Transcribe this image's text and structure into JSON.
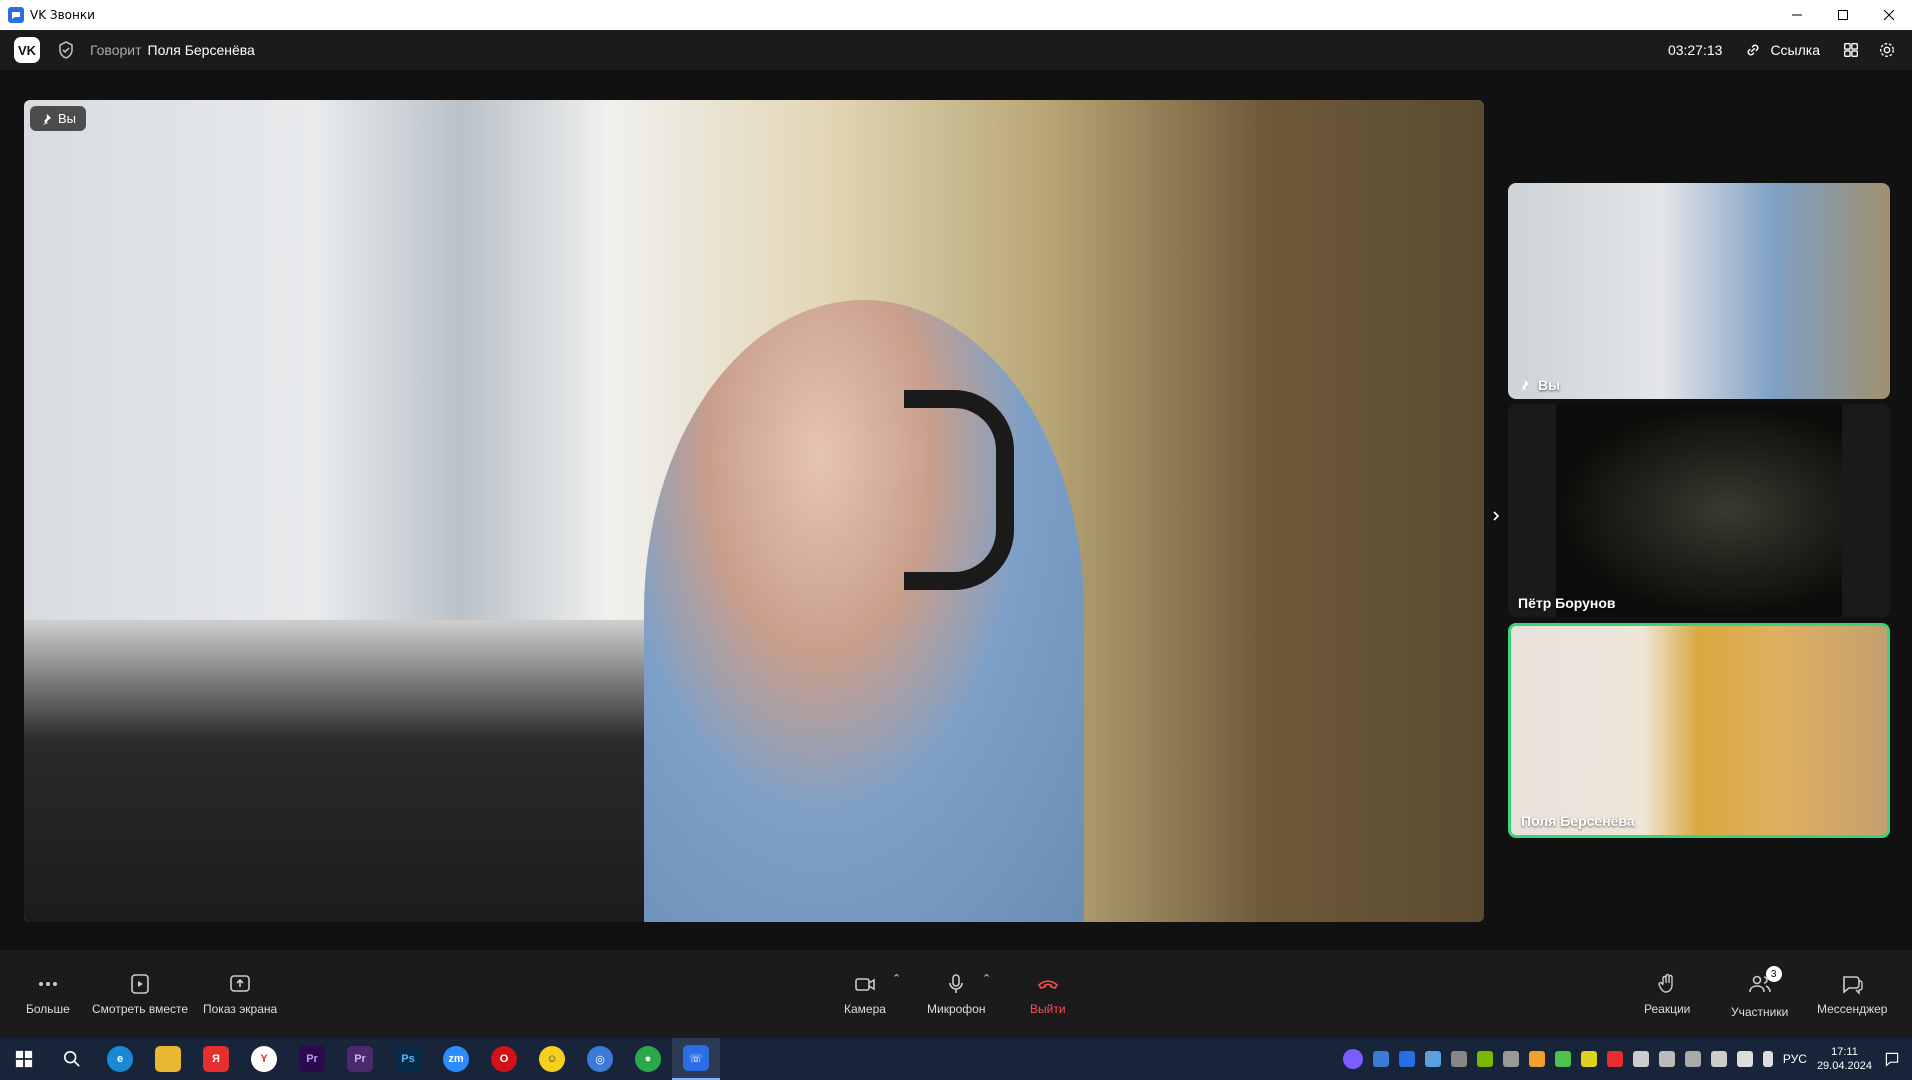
{
  "window": {
    "title": "VK Звонки"
  },
  "header": {
    "speaking_label": "Говорит",
    "speaking_name": "Поля Берсенёва",
    "timer": "03:27:13",
    "link_label": "Ссылка"
  },
  "main_video": {
    "badge_label": "Вы"
  },
  "tiles": [
    {
      "name": "Вы"
    },
    {
      "name": "Пётр Борунов"
    },
    {
      "name": "Поля Берсенёва"
    }
  ],
  "toolbar": {
    "more": "Больше",
    "watch_together": "Смотреть вместе",
    "screen_share": "Показ экрана",
    "camera": "Камера",
    "microphone": "Микрофон",
    "leave": "Выйти",
    "reactions": "Реакции",
    "participants": "Участники",
    "participants_count": "3",
    "messenger": "Мессенджер"
  },
  "taskbar": {
    "apps": [
      "start-icon",
      "search-icon",
      "edge-icon",
      "explorer-icon",
      "yandex-icon",
      "yandex-browser-icon",
      "premiere-icon",
      "premiere-rush-icon",
      "photoshop-icon",
      "zoom-icon",
      "opera-icon",
      "smiley-app-icon",
      "globe-app-icon",
      "chrome-icon",
      "vk-calls-icon"
    ],
    "language": "РУС",
    "time": "17:11",
    "date": "29.04.2024"
  },
  "colors": {
    "accent_active_speaker": "#3cd47a",
    "leave_red": "#ff4d4d",
    "taskbar": "#17243a"
  }
}
